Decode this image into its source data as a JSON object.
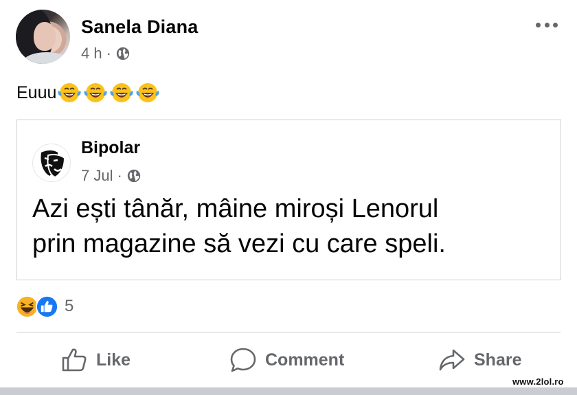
{
  "post": {
    "author": "Sanela Diana",
    "time": "4 h",
    "separator": "·",
    "privacy_icon": "globe-icon",
    "more_icon": "more-dots-icon",
    "text": "Euuu",
    "emojis": [
      "laughing-tears-emoji",
      "laughing-tears-emoji",
      "laughing-tears-emoji",
      "laughing-tears-emoji"
    ]
  },
  "shared": {
    "page_name": "Bipolar",
    "date": "7 Jul",
    "separator": "·",
    "privacy_icon": "globe-icon",
    "text_line1": "Azi ești tânăr, mâine miroși Lenorul",
    "text_line2": "prin magazine să vezi cu care speli."
  },
  "reactions": {
    "icons": [
      "haha-reaction-icon",
      "like-reaction-icon"
    ],
    "count": "5"
  },
  "actions": {
    "like_label": "Like",
    "comment_label": "Comment",
    "share_label": "Share"
  },
  "watermark": "www.2lol.ro",
  "colors": {
    "text_primary": "#050505",
    "text_secondary": "#65676b",
    "border": "#ced0d4",
    "like_blue": "#1877f2",
    "haha_yellow": "#f7b125"
  }
}
